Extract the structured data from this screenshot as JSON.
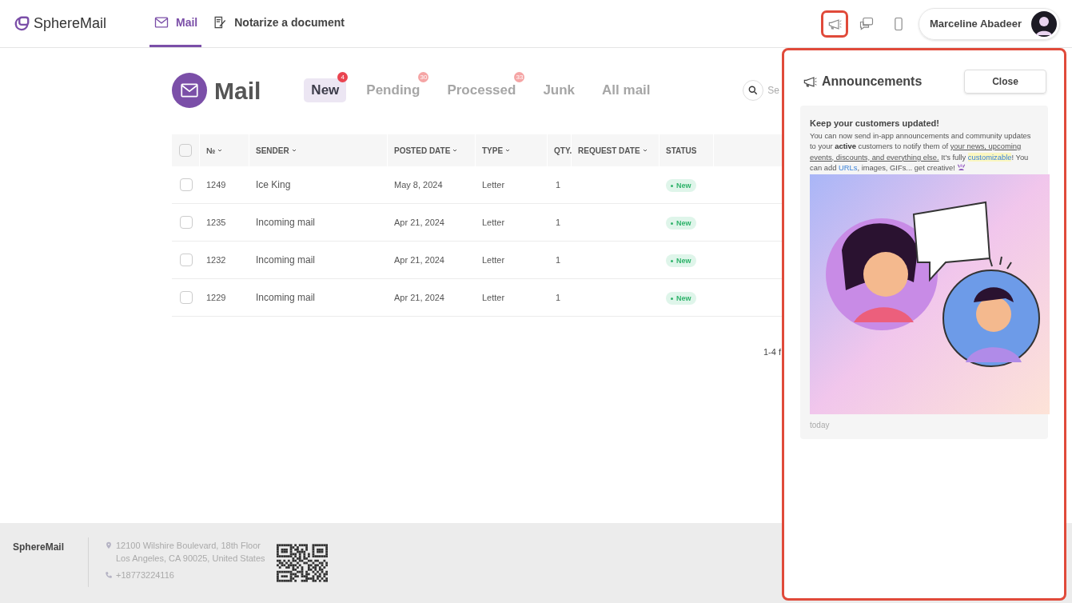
{
  "brand": "SphereMail",
  "nav": [
    {
      "label": "Mail",
      "selected": true,
      "kind": "mail"
    },
    {
      "label": "Notarize a document",
      "selected": false,
      "kind": "notarize"
    }
  ],
  "header_icons": [
    {
      "kind": "announcements",
      "highlighted": true
    },
    {
      "kind": "chat",
      "highlighted": false
    },
    {
      "kind": "phone",
      "highlighted": false
    }
  ],
  "user": {
    "name": "Marceline Abadeer"
  },
  "page_title": "Mail",
  "tabs": [
    {
      "label": "New",
      "selected": true,
      "count": "4"
    },
    {
      "label": "Pending",
      "selected": false,
      "count": "30"
    },
    {
      "label": "Processed",
      "selected": false,
      "count": "33"
    },
    {
      "label": "Junk",
      "selected": false
    },
    {
      "label": "All mail",
      "selected": false
    }
  ],
  "search": {
    "placeholder": "Se"
  },
  "table": {
    "select_all": {
      "checked": false
    },
    "columns": [
      {
        "label": "№",
        "sortable": true
      },
      {
        "label": "SENDER",
        "sortable": true
      },
      {
        "label": "POSTED DATE",
        "sortable": true
      },
      {
        "label": "TYPE",
        "sortable": true
      },
      {
        "label": "QTY.",
        "sortable": false
      },
      {
        "label": "REQUEST DATE",
        "sortable": true
      },
      {
        "label": "STATUS",
        "sortable": false
      }
    ],
    "rows": [
      {
        "checked": false,
        "number": "1249",
        "sender": "Ice King",
        "posted_date": "May 8, 2024",
        "type": "Letter",
        "qty": "1",
        "status": "New"
      },
      {
        "checked": false,
        "number": "1235",
        "sender": "Incoming mail",
        "posted_date": "Apr 21, 2024",
        "type": "Letter",
        "qty": "1",
        "status": "New"
      },
      {
        "checked": false,
        "number": "1232",
        "sender": "Incoming mail",
        "posted_date": "Apr 21, 2024",
        "type": "Letter",
        "qty": "1",
        "status": "New"
      },
      {
        "checked": false,
        "number": "1229",
        "sender": "Incoming mail",
        "posted_date": "Apr 21, 2024",
        "type": "Letter",
        "qty": "1",
        "status": "New"
      }
    ]
  },
  "pagination": "1-4 f",
  "footer": {
    "brand": "SphereMail",
    "address": [
      "12100 Wilshire Boulevard, 18th Floor",
      "Los Angeles, CA 90025, United States"
    ],
    "phone": "+18773224116"
  },
  "panel": {
    "title": "Announcements",
    "close": "Close",
    "announcement": {
      "heading": "Keep your customers updated!",
      "segments": [
        {
          "kind": "plain",
          "text": "You can now send in-app announcements and community updates to your "
        },
        {
          "kind": "bold",
          "text": "active"
        },
        {
          "kind": "plain",
          "text": " customers to notify them of "
        },
        {
          "kind": "underline",
          "text": "your news, upcoming events, discounts, and everything else."
        },
        {
          "kind": "plain",
          "text": " It's fully "
        },
        {
          "kind": "highlight_link",
          "text": "customizable"
        },
        {
          "kind": "plain",
          "text": "! You can add "
        },
        {
          "kind": "link",
          "text": "URLs"
        },
        {
          "kind": "plain",
          "text": ", images, GIFs... get creative! "
        }
      ],
      "time": "today"
    }
  }
}
